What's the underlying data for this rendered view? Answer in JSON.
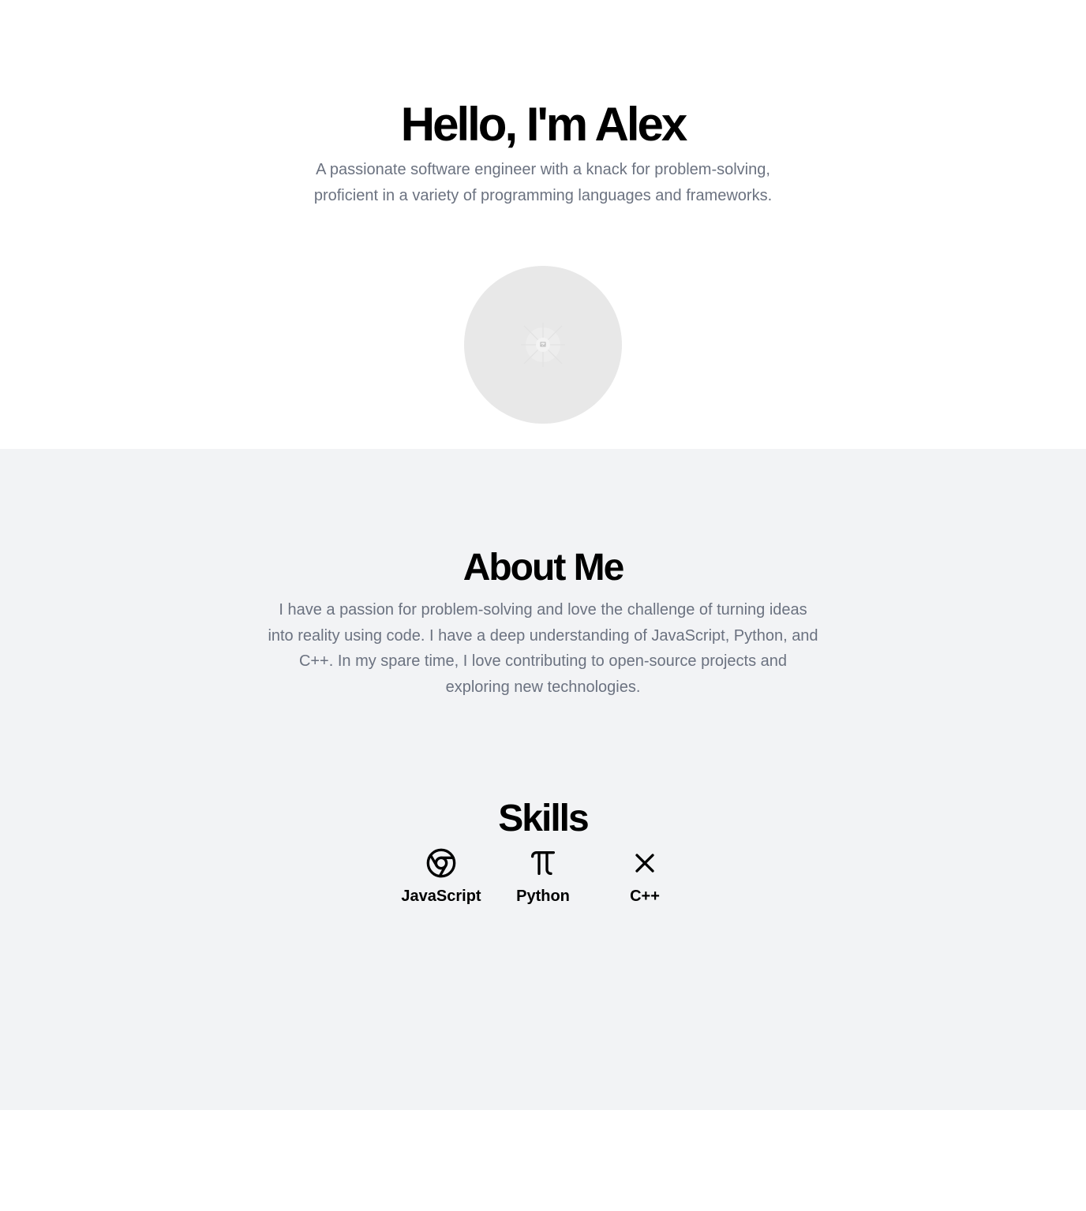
{
  "hero": {
    "title": "Hello, I'm Alex",
    "subtitle": "A passionate software engineer with a knack for problem-solving, proficient in a variety of programming languages and frameworks.",
    "avatar_icon": "image-placeholder-icon"
  },
  "about": {
    "title": "About Me",
    "text": "I have a passion for problem-solving and love the challenge of turning ideas into reality using code. I have a deep understanding of JavaScript, Python, and C++. In my spare time, I love contributing to open-source projects and exploring new technologies."
  },
  "skills": {
    "title": "Skills",
    "items": [
      {
        "label": "JavaScript",
        "icon": "chrome-icon"
      },
      {
        "label": "Python",
        "icon": "pi-icon"
      },
      {
        "label": "C++",
        "icon": "x-icon"
      }
    ]
  },
  "colors": {
    "muted_text": "#6b7280",
    "section_bg": "#f2f3f5",
    "avatar_bg": "#e8e8e8"
  }
}
